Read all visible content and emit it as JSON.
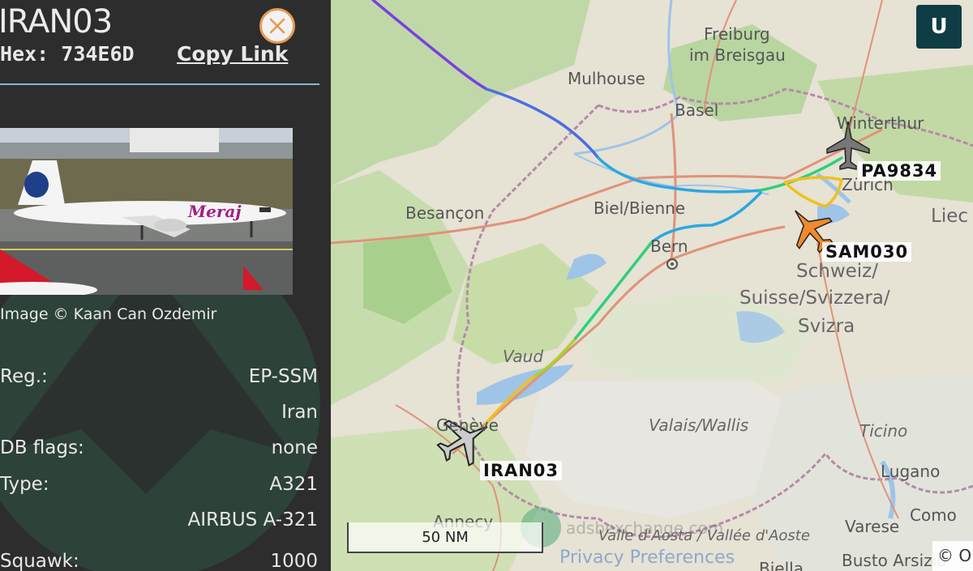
{
  "sidebar": {
    "callsign": "IRAN03",
    "hex_label": "Hex:",
    "hex_value": "734E6D",
    "copy_link": "Copy Link",
    "photo_credit": "Image © Kaan Can Ozdemir",
    "photo_airline_text": "Meraj",
    "rows": [
      {
        "label": "Reg.:",
        "value": "EP-SSM"
      },
      {
        "label": "",
        "value": "Iran"
      },
      {
        "label": "DB flags:",
        "value": "none"
      },
      {
        "label": "Type:",
        "value": "A321"
      },
      {
        "label": "",
        "value": "AIRBUS A-321"
      },
      {
        "label": "Squawk:",
        "value": "1000"
      }
    ]
  },
  "map": {
    "user_button": "U",
    "scale": "50 NM",
    "copyright": "© O",
    "privacy": "Privacy Preferences",
    "watermark_url": "adsbexchange.com",
    "places": [
      {
        "name": "Freiburg",
        "id": "freiburg"
      },
      {
        "name": "im Breisgau",
        "id": "breisgau"
      },
      {
        "name": "Mulhouse",
        "id": "mulhouse"
      },
      {
        "name": "Basel",
        "id": "basel"
      },
      {
        "name": "Winterthur",
        "id": "winterthur"
      },
      {
        "name": "Zürich",
        "id": "zurich"
      },
      {
        "name": "Liec",
        "id": "liec"
      },
      {
        "name": "Besançon",
        "id": "besancon"
      },
      {
        "name": "Biel/Bienne",
        "id": "biel"
      },
      {
        "name": "Bern",
        "id": "bern"
      },
      {
        "name": "Schweiz/",
        "id": "schweiz"
      },
      {
        "name": "Suisse/Svizzera/",
        "id": "suisse"
      },
      {
        "name": "Svizra",
        "id": "svizra"
      },
      {
        "name": "Vaud",
        "id": "vaud"
      },
      {
        "name": "Genève",
        "id": "geneve"
      },
      {
        "name": "Valais/Wallis",
        "id": "valais"
      },
      {
        "name": "Ticino",
        "id": "ticino"
      },
      {
        "name": "Lugano",
        "id": "lugano"
      },
      {
        "name": "Como",
        "id": "como"
      },
      {
        "name": "Varese",
        "id": "varese"
      },
      {
        "name": "Annecy",
        "id": "annecy"
      },
      {
        "name": "Valle d'Aosta / Vallée d'Aoste",
        "id": "aosta"
      },
      {
        "name": "Busto Arsizio",
        "id": "busto"
      },
      {
        "name": "Biella",
        "id": "biella"
      }
    ],
    "aircraft": [
      {
        "callsign": "IRAN03",
        "color": "#cccccc",
        "selected": true
      },
      {
        "callsign": "PA9834",
        "color": "#cccccc",
        "selected": false
      },
      {
        "callsign": "SAM030",
        "color": "#f08a2c",
        "selected": false
      }
    ],
    "track_colors": [
      "#7b3fe0",
      "#4a6fe0",
      "#2aa8e0",
      "#2fd07a",
      "#a6d52a",
      "#f0c020"
    ]
  }
}
